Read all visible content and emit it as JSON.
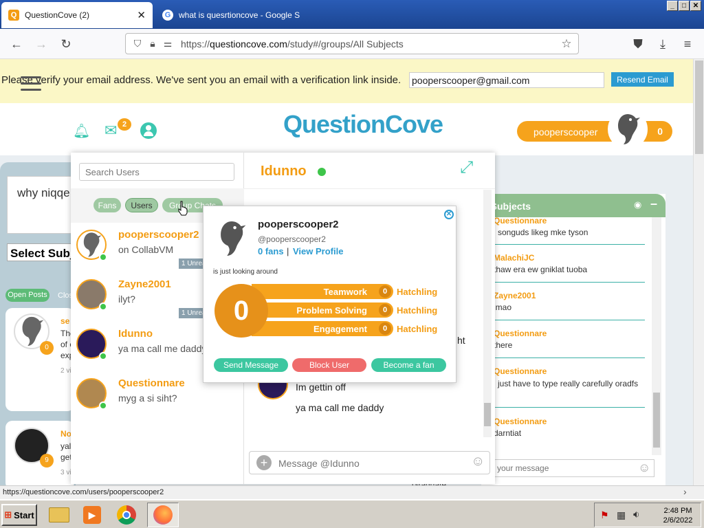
{
  "browser": {
    "tabs": [
      {
        "title": "QuestionCove (2)",
        "active": true
      },
      {
        "title": "what is quesrtioncove - Google Sea",
        "active": false
      }
    ],
    "url_prefix": "https://",
    "url_domain": "questioncove.com",
    "url_path": "/study#/groups/All Subjects"
  },
  "banner": {
    "message": "Please verify your email address. We've sent you an email with a verification link inside.",
    "email_value": "pooperscooper@gmail.com",
    "resend_label": "Resend Email"
  },
  "header": {
    "logo": "QuestionCove",
    "mail_count": "2",
    "username": "pooperscooper",
    "score": "0"
  },
  "chat": {
    "search_placeholder": "Search Users",
    "filters": [
      "Fans",
      "Users",
      "Group Chats"
    ],
    "conversations": [
      {
        "name": "pooperscooper2",
        "preview": "on CollabVM",
        "unread": "1 Unread"
      },
      {
        "name": "Zayne2001",
        "preview": "ilyt?",
        "unread": "1 Unread"
      },
      {
        "name": "Idunno",
        "preview": "ya ma call me daddy",
        "unread": ""
      },
      {
        "name": "Questionnare",
        "preview": "myg a si siht?",
        "unread": ""
      }
    ],
    "active_user": "Idunno",
    "messages": [
      "Im gettin off",
      "ya ma call me daddy"
    ],
    "partial_word": "ht",
    "message_placeholder": "Message @Idunno"
  },
  "profile_popup": {
    "name": "pooperscooper2",
    "handle": "@pooperscooper2",
    "fans": "0 fans",
    "separator": "|",
    "view_profile": "View Profile",
    "status": "is just looking around",
    "score": "0",
    "stats": [
      {
        "label": "Teamwork",
        "value": "0",
        "tier": "Hatchling"
      },
      {
        "label": "Problem Solving",
        "value": "0",
        "tier": "Hatchling"
      },
      {
        "label": "Engagement",
        "value": "0",
        "tier": "Hatchling"
      }
    ],
    "buttons": {
      "send": "Send Message",
      "block": "Block User",
      "fan": "Become a fan"
    }
  },
  "group_chat": {
    "title": "ll Subjects",
    "messages": [
      {
        "user": "Questionnare",
        "text": "i songuds likeg mke tyson"
      },
      {
        "user": "MalachiJC",
        "text": "thaw era ew gniklat tuoba"
      },
      {
        "user": "Zayne2001",
        "text": "lmao"
      },
      {
        "user": "Questionnare",
        "text": "there"
      },
      {
        "user": "Questionnare",
        "text": "i just have to type really carefully oradfs"
      },
      {
        "user": "Questionnare",
        "text": "darntiat"
      }
    ],
    "input_placeholder": "your message"
  },
  "background": {
    "question_text": "why niqqe",
    "select_subject": "Select Subj",
    "open_posts": "Open Posts",
    "closed": "Clos",
    "card1": {
      "user": "se",
      "lines": [
        "The",
        "of c",
        "exp"
      ],
      "meta": "2 vi",
      "badge": "0"
    },
    "card2": {
      "user": "No",
      "lines": [
        "yal",
        "get"
      ],
      "meta": "3 vi",
      "badge": "9"
    },
    "graduate": "Graduate"
  },
  "status_link": "https://questioncove.com/users/pooperscooper2",
  "taskbar": {
    "start": "Start",
    "time": "2:48 PM",
    "date": "2/6/2022"
  },
  "colors": {
    "accent_orange": "#f6a31c",
    "brand_teal": "#33a1c9",
    "online_green": "#3ec54a",
    "banner_yellow": "#fbf7c6"
  }
}
